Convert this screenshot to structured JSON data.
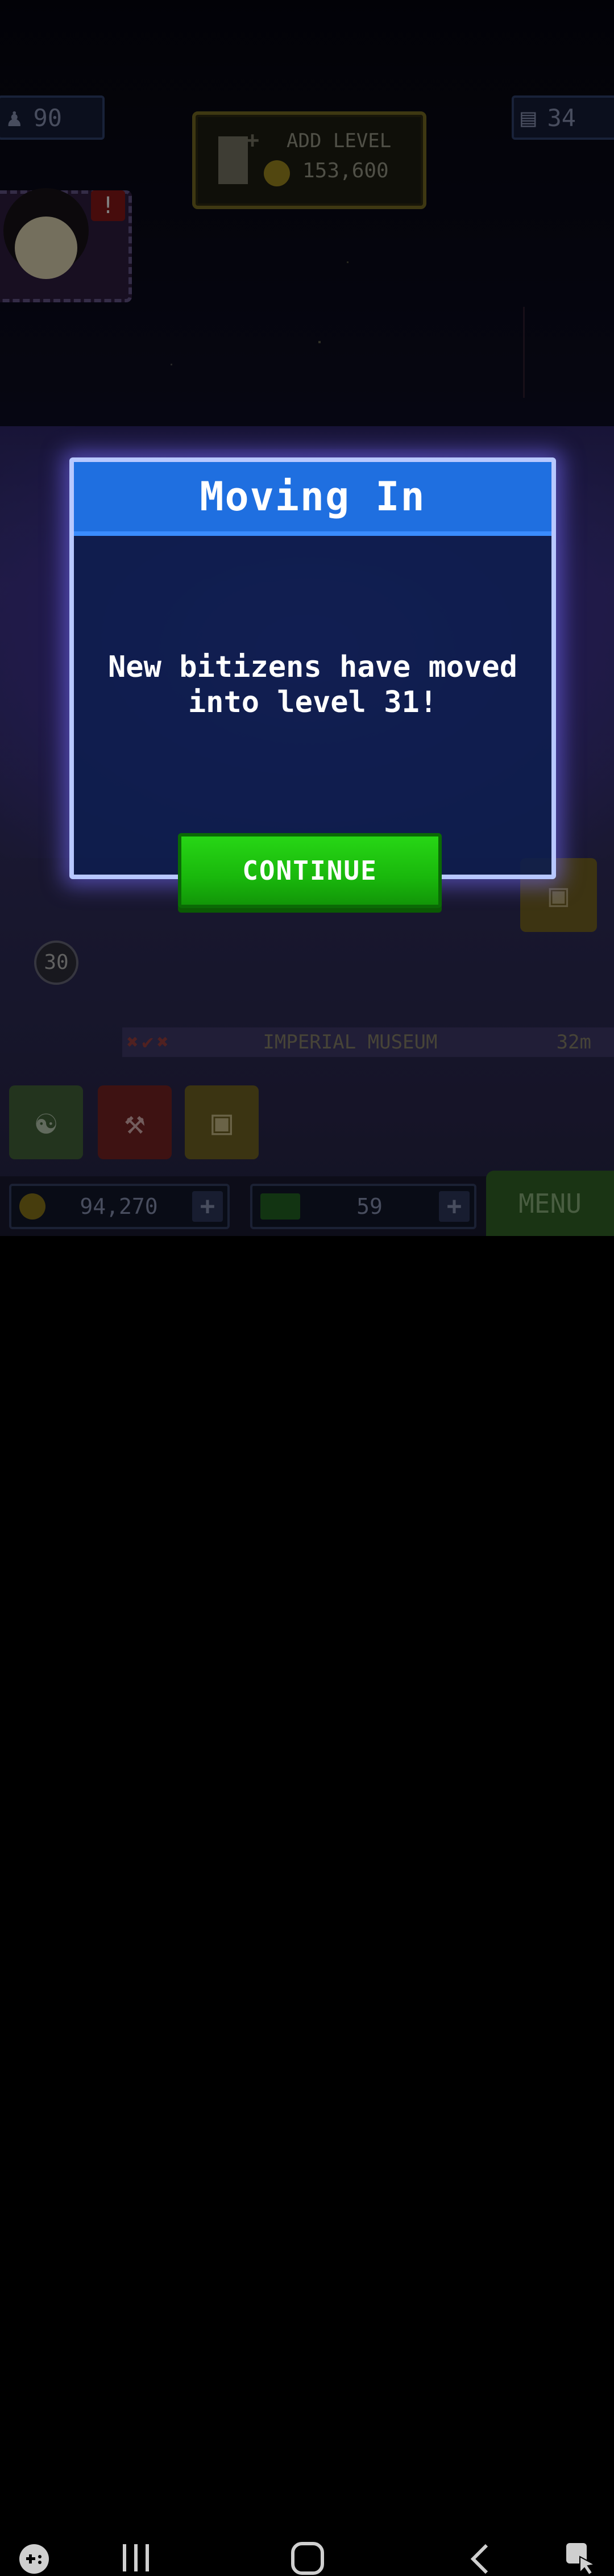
{
  "hud": {
    "population": "90",
    "floors": "34",
    "add_level": {
      "label": "ADD LEVEL",
      "cost": "153,600"
    }
  },
  "tower": {
    "floor_number": "30",
    "floor_name": "IMPERIAL MUSEUM",
    "floor_meta": "32m"
  },
  "bottom_bar": {
    "coins": "94,270",
    "bux": "59",
    "menu": "MENU"
  },
  "dialog": {
    "title": "Moving In",
    "message": "New bitizens have moved into level 31!",
    "continue_label": "CONTINUE"
  },
  "icons": {
    "population": "person-icon",
    "floors": "building-icon",
    "coin": "coin-icon",
    "bux": "bux-icon",
    "alert": "exclamation-icon"
  }
}
